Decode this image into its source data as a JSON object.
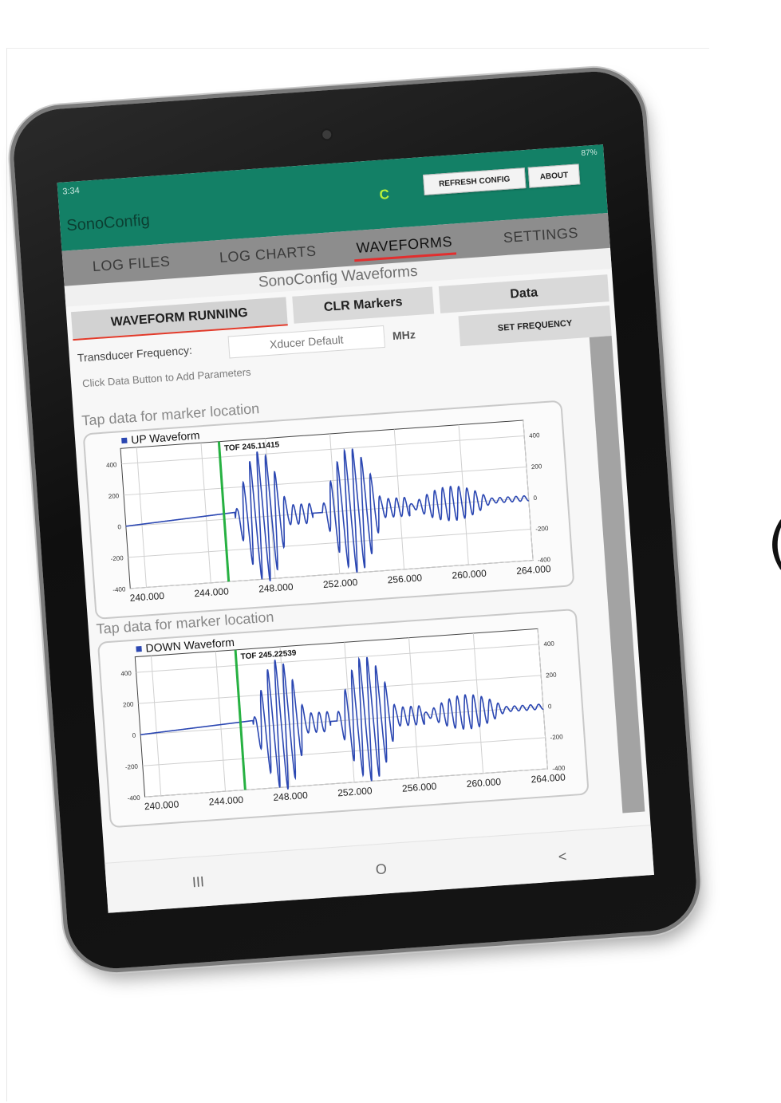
{
  "status": {
    "time": "3:34",
    "battery": "87%"
  },
  "header": {
    "title": "SonoConfig",
    "connection": "C",
    "refresh_button": "REFRESH CONFIG",
    "about_button": "ABOUT"
  },
  "tabs": [
    {
      "label": "LOG FILES"
    },
    {
      "label": "LOG CHARTS"
    },
    {
      "label": "WAVEFORMS",
      "active": true
    },
    {
      "label": "SETTINGS"
    }
  ],
  "waveforms": {
    "title": "SonoConfig Waveforms",
    "running_button": "WAVEFORM RUNNING",
    "clr_markers_button": "CLR Markers",
    "data_button": "Data",
    "freq_label": "Transducer Frequency:",
    "freq_placeholder": "Xducer Default",
    "freq_unit": "MHz",
    "set_frequency_button": "SET FREQUENCY",
    "hint": "Click Data Button to Add Parameters",
    "tap_hint": "Tap data for marker location"
  },
  "nav": {
    "recents": "III",
    "home": "O",
    "back": "<"
  },
  "edge_glyph": "(",
  "colors": {
    "accent": "#138066",
    "tab_underline": "#e22e2e",
    "series": "#2b47b2",
    "marker": "#27b142"
  },
  "chart_data": [
    {
      "type": "line",
      "legend": "UP Waveform",
      "marker_label": "TOF 245.11415",
      "marker_x": 245.11,
      "x_ticks": [
        "240.000",
        "244.000",
        "248.000",
        "252.000",
        "256.000",
        "260.000",
        "264.000"
      ],
      "y_ticks_left": [
        "400",
        "200",
        "0",
        "-200",
        "-400"
      ],
      "y_ticks_right": [
        "400",
        "200",
        "0",
        "-200",
        "-400"
      ],
      "xlim": [
        239,
        264
      ],
      "ylim": [
        -400,
        500
      ],
      "bursts": [
        {
          "start": 245.8,
          "end": 250.6,
          "amp": 420,
          "freq": 2.0
        },
        {
          "start": 251.2,
          "end": 256.6,
          "amp": 400,
          "freq": 2.0
        },
        {
          "start": 256.6,
          "end": 264,
          "amp": 110,
          "freq": 2.0
        }
      ],
      "baseline": [
        [
          239,
          0
        ],
        [
          245.8,
          40
        ]
      ]
    },
    {
      "type": "line",
      "legend": "DOWN Waveform",
      "marker_label": "TOF 245.22539",
      "marker_x": 245.23,
      "x_ticks": [
        "240.000",
        "244.000",
        "248.000",
        "252.000",
        "256.000",
        "260.000",
        "264.000"
      ],
      "y_ticks_left": [
        "400",
        "200",
        "0",
        "-200",
        "-400"
      ],
      "y_ticks_right": [
        "400",
        "200",
        "0",
        "-200",
        "-400"
      ],
      "xlim": [
        239,
        264
      ],
      "ylim": [
        -400,
        500
      ],
      "bursts": [
        {
          "start": 246.0,
          "end": 250.8,
          "amp": 420,
          "freq": 2.0
        },
        {
          "start": 251.2,
          "end": 256.6,
          "amp": 400,
          "freq": 2.0
        },
        {
          "start": 256.6,
          "end": 264,
          "amp": 110,
          "freq": 2.0
        }
      ],
      "baseline": [
        [
          239,
          0
        ],
        [
          246.0,
          40
        ]
      ]
    }
  ]
}
